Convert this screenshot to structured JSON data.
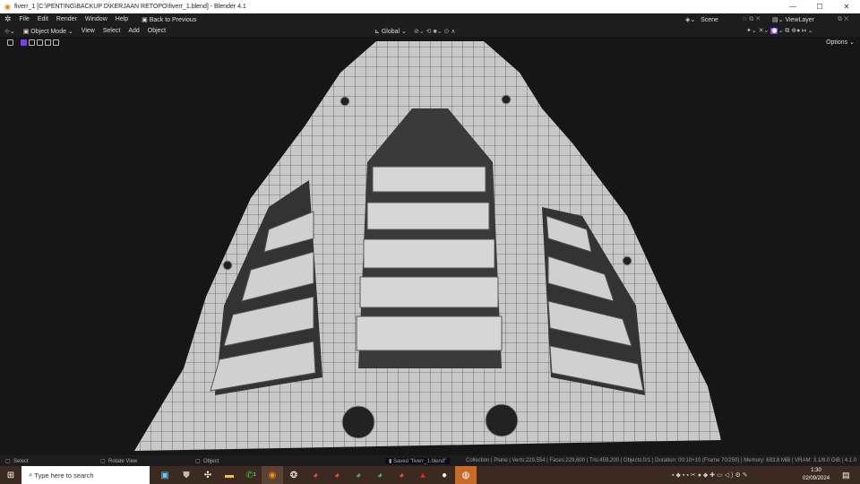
{
  "window": {
    "title": "fiverr_1 [C:\\PENTING\\BACKUP D\\KERJAAN RETOPO\\fiverr_1.blend] - Blender 4.1",
    "minimize": "—",
    "maximize": "☐",
    "close": "✕"
  },
  "menu": {
    "items": [
      "File",
      "Edit",
      "Render",
      "Window",
      "Help"
    ],
    "back": "Back to Previous",
    "scene": "Scene",
    "view_layer": "ViewLayer"
  },
  "header": {
    "mode": "Object Mode",
    "items": [
      "View",
      "Select",
      "Add",
      "Object"
    ],
    "orientation": "Global",
    "options": "Options"
  },
  "status": {
    "left": [
      {
        "label": "Select"
      },
      {
        "label": "Rotate View"
      },
      {
        "label": "Object"
      }
    ],
    "saved": "Saved \"fiverr_1.blend\"",
    "stats": "Collection | Plane | Verts:229,554 | Faces:229,600 | Tris:459,200 | Objects:0/1 | Duration: 00:10+10 (Frame 70/250) | Memory: 683.8 MiB | VRAM: 3.1/8.0 GiB | 4.1.0"
  },
  "taskbar": {
    "search_placeholder": "Type here to search",
    "time": "1:30",
    "date": "02/09/2024",
    "whatsapp_badge": "1"
  },
  "colors": {
    "accent": "#7b3ff2",
    "mesh": "#c9c9c9",
    "taskbar": "#3a2a20"
  }
}
